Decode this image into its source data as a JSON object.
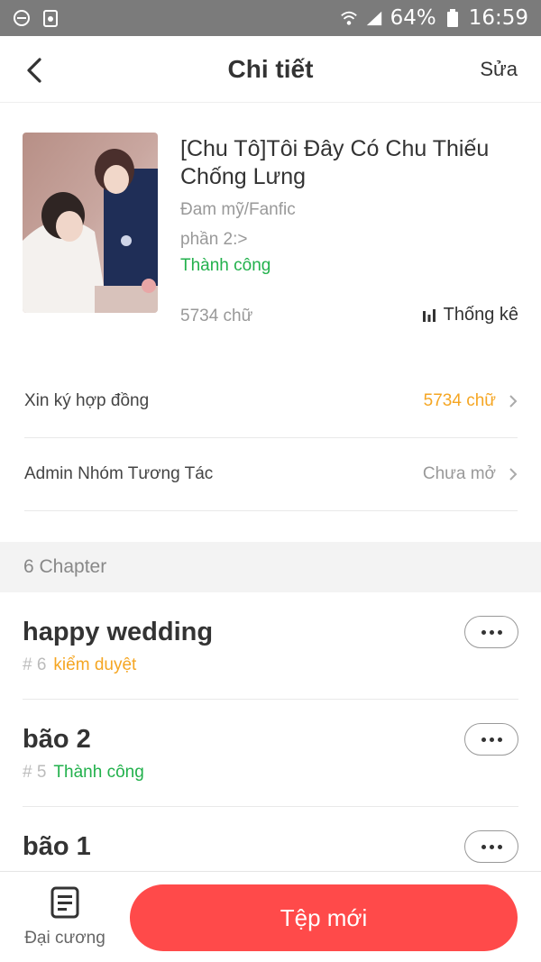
{
  "status_bar": {
    "battery": "64%",
    "time": "16:59"
  },
  "header": {
    "title": "Chi tiết",
    "edit_label": "Sửa"
  },
  "book": {
    "title": "[Chu Tô]Tôi Đây Có Chu Thiếu Chống Lưng",
    "genre": "Đam mỹ/Fanfic",
    "part": "phần 2:>",
    "status": "Thành công",
    "word_count": "5734 chữ",
    "stats_label": "Thống kê"
  },
  "rows": [
    {
      "label": "Xin ký hợp đồng",
      "value": "5734 chữ",
      "value_color": "#f5a623"
    },
    {
      "label": "Admin Nhóm Tương Tác",
      "value": "Chưa mở",
      "value_color": "#999999"
    }
  ],
  "chapters_header": "6 Chapter",
  "chapters": [
    {
      "title": "happy wedding",
      "number": "# 6",
      "status": "kiểm duyệt",
      "status_color": "#f5a623"
    },
    {
      "title": "bão 2",
      "number": "# 5",
      "status": "Thành công",
      "status_color": "#22b14c"
    },
    {
      "title": "bão 1",
      "number": "",
      "status": "",
      "status_color": "#22b14c"
    }
  ],
  "bottom_bar": {
    "outline_label": "Đại cương",
    "new_button": "Tệp mới"
  },
  "colors": {
    "accent": "#ff4a4a",
    "success": "#22b14c",
    "warning": "#f5a623"
  }
}
